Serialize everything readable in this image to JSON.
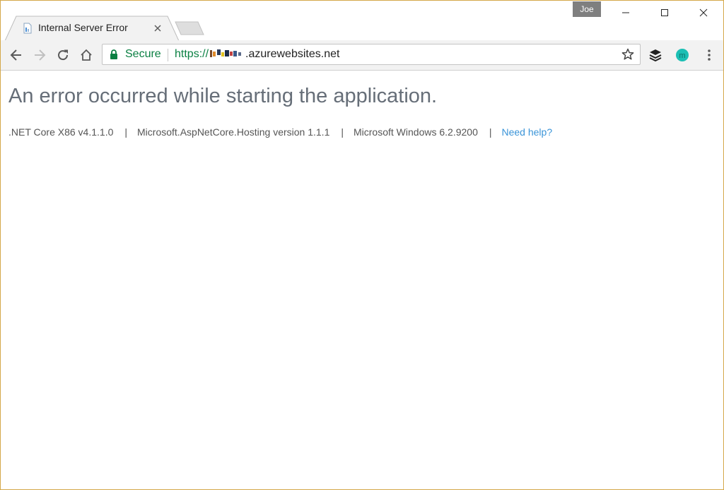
{
  "window": {
    "profile_name": "Joe",
    "controls": {
      "minimize_icon": "minimize-icon",
      "maximize_icon": "maximize-icon",
      "close_icon": "close-icon"
    }
  },
  "tab": {
    "title": "Internal Server Error",
    "favicon": "page-icon"
  },
  "toolbar": {
    "back_icon": "back-arrow-icon",
    "forward_icon": "forward-arrow-icon",
    "reload_icon": "reload-icon",
    "home_icon": "home-icon",
    "secure_label": "Secure",
    "url_scheme": "https://",
    "url_host": ".azurewebsites.net",
    "bookmark_icon": "star-icon",
    "extension_icons": [
      "buffer-icon",
      "m-extension-icon"
    ],
    "menu_icon": "kebab-menu-icon"
  },
  "page": {
    "title": "An error occurred while starting the application.",
    "runtime": ".NET Core X86 v4.1.1.0",
    "hosting": "Microsoft.AspNetCore.Hosting version 1.1.1",
    "os": "Microsoft Windows 6.2.9200",
    "help_link": "Need help?",
    "separator": "|"
  },
  "colors": {
    "window_border": "#d4a84a",
    "secure_green": "#0b8043",
    "link_blue": "#3a94d8",
    "title_gray": "#666e78",
    "profile_badge": "#7f7f7f",
    "extension_teal": "#1bbfb4"
  }
}
